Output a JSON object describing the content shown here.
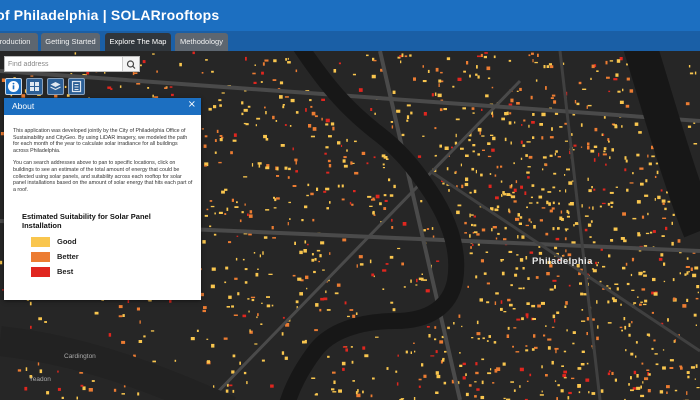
{
  "header": {
    "title": "y of Philadelphia | SOLARrooftops"
  },
  "tabs": [
    {
      "label": "troduction"
    },
    {
      "label": "Getting Started"
    },
    {
      "label": "Explore The Map"
    },
    {
      "label": "Methodology"
    }
  ],
  "search": {
    "placeholder": "Find address",
    "button_icon": "search-icon"
  },
  "tools": [
    {
      "icon": "info-icon"
    },
    {
      "icon": "basemap-gallery-icon"
    },
    {
      "icon": "layers-icon"
    },
    {
      "icon": "legend-icon"
    }
  ],
  "about_panel": {
    "title": "About",
    "close_label": "×",
    "paragraph1": "This application was developed jointly by the City of Philadelphia Office of Sustainability and CityGeo. By using LiDAR imagery, we modeled the path for each month of the year to calculate solar irradiance for all buildings across Philadelphia.",
    "paragraph2": "You can search addresses above to pan to specific locations, click on buildings to see an estimate of the total amount of energy that could be collected using solar panels, and suitability across each rooftop for solar panel installations based on the amount of solar energy that hits each part of a roof.",
    "legend_title": "Estimated Suitability for Solar Panel Installation",
    "legend": [
      {
        "label": "Good",
        "color": "#f9c64e"
      },
      {
        "label": "Better",
        "color": "#ec7c32"
      },
      {
        "label": "Best",
        "color": "#e0261f"
      }
    ]
  },
  "map": {
    "labels": [
      {
        "text": "Philadelphia"
      },
      {
        "text": "Cardington"
      },
      {
        "text": "Yeadon"
      }
    ],
    "colors": {
      "background": "#262626",
      "water": "#171717",
      "roads": "#4a4a4a",
      "good": "#f9c64e",
      "better": "#ec7c32",
      "best": "#e0261f"
    }
  }
}
